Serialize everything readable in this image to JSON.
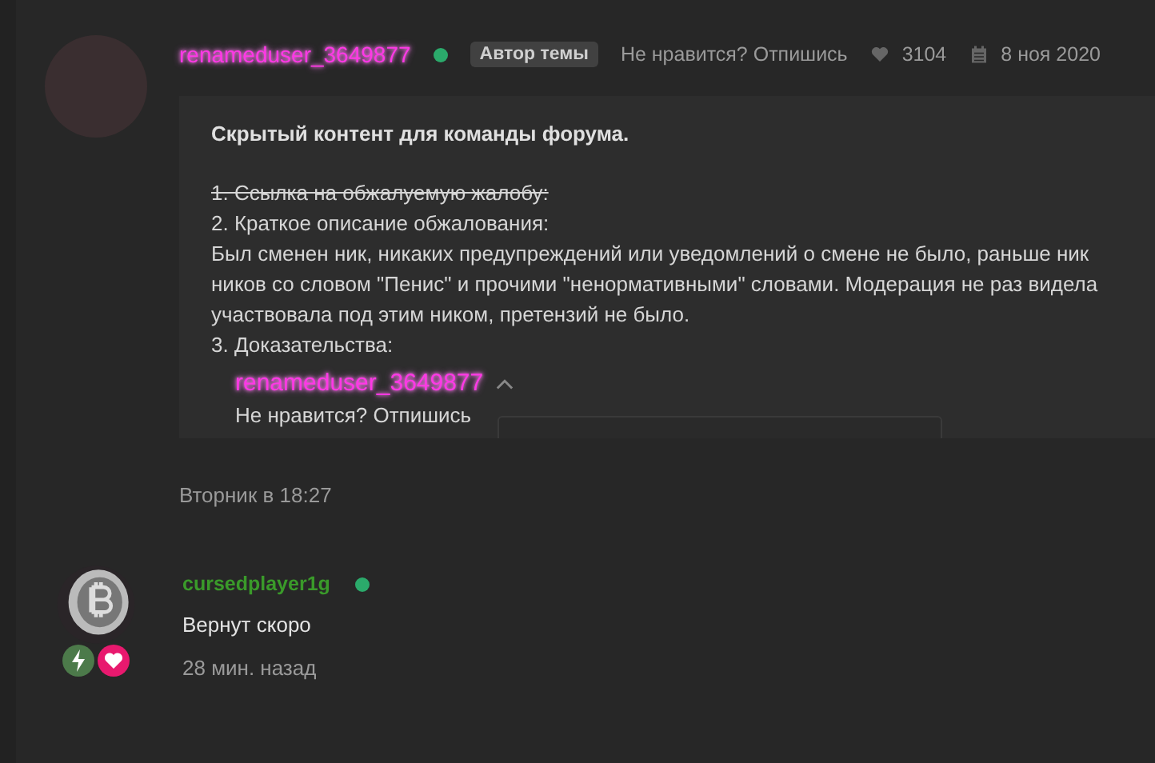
{
  "posts": [
    {
      "author": "renameduser_3649877",
      "online": true,
      "author_badge": "Автор темы",
      "signature": "Не нравится? Отпишись",
      "likes": "3104",
      "date": "8 ноя 2020",
      "spoiler": {
        "title": "Скрытый контент для команды форума.",
        "lines": [
          {
            "text": "1. Ссылка на обжалуемую жалобу:",
            "struck": true
          },
          {
            "text": "2. Краткое описание обжалования:",
            "struck": false
          },
          {
            "text": "Был сменен ник, никаких предупреждений или уведомлений о смене не было, раньше ник",
            "struck": false
          },
          {
            "text": "ников со словом \"Пенис\" и прочими \"ненормативными\" словами. Модерация не раз видела",
            "struck": false
          },
          {
            "text": "участвовала под этим ником, претензий не было.",
            "struck": false
          },
          {
            "text": "3. Доказательства:",
            "struck": false
          }
        ],
        "quote": {
          "author": "renameduser_3649877",
          "signature": "Не нравится? Отпишись"
        }
      },
      "time": "Вторник в 18:27"
    },
    {
      "author": "cursedplayer1g",
      "online": true,
      "text": "Вернут скоро",
      "time": "28 мин. назад"
    }
  ]
}
